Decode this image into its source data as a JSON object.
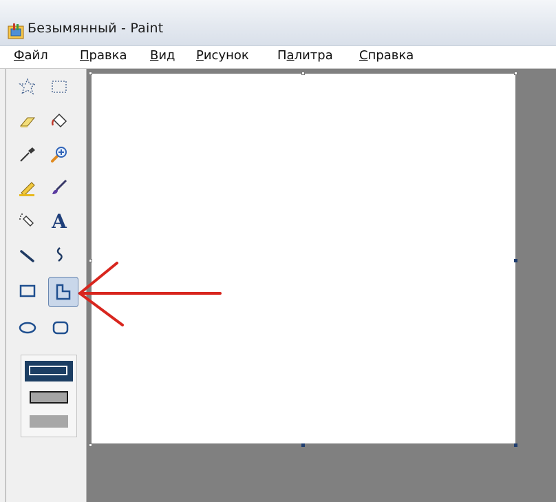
{
  "window": {
    "title": "Безымянный - Paint"
  },
  "menu": {
    "items": [
      {
        "accel": "Ф",
        "rest": "айл"
      },
      {
        "accel": "П",
        "rest": "равка"
      },
      {
        "accel": "В",
        "rest": "ид"
      },
      {
        "accel": "Р",
        "rest": "исунок"
      },
      {
        "pre": "П",
        "accel": "а",
        "rest": "литра"
      },
      {
        "accel": "С",
        "rest": "правка"
      }
    ]
  },
  "tools": [
    {
      "icon": "free-select-icon"
    },
    {
      "icon": "rect-select-icon"
    },
    {
      "icon": "eraser-icon"
    },
    {
      "icon": "fill-bucket-icon"
    },
    {
      "icon": "color-picker-icon"
    },
    {
      "icon": "magnifier-icon"
    },
    {
      "icon": "pencil-icon"
    },
    {
      "icon": "brush-icon"
    },
    {
      "icon": "airbrush-icon"
    },
    {
      "icon": "text-icon",
      "glyph": "A"
    },
    {
      "icon": "line-icon"
    },
    {
      "icon": "curve-icon"
    },
    {
      "icon": "rectangle-icon"
    },
    {
      "icon": "polygon-icon",
      "selected": true
    },
    {
      "icon": "ellipse-icon"
    },
    {
      "icon": "rounded-rectangle-icon"
    }
  ],
  "options": [
    "fill-with-outline",
    "outline-only",
    "fill-only"
  ],
  "colors": {
    "annotation_arrow": "#d8261e",
    "selection": "#c9d7ea",
    "workspace": "#808080",
    "option_dark": "#1c3e63"
  }
}
